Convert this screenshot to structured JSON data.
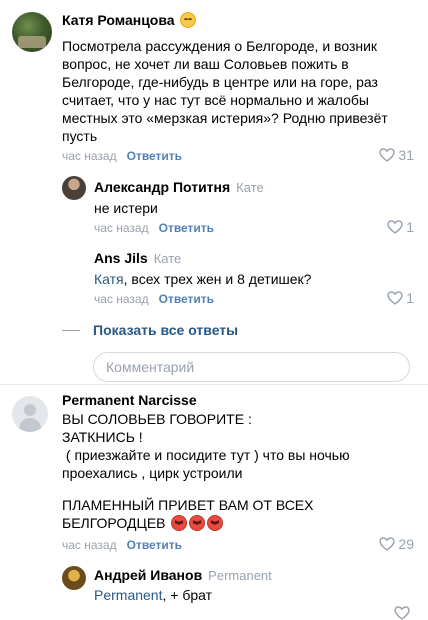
{
  "comments": [
    {
      "author": "Катя Романцова",
      "text": "Посмотрела рассуждения о Белгороде, и возник вопрос, не хочет ли ваш Соловьев пожить в Белгороде, где-нибудь в центре или на горе, раз считает, что у нас тут всё нормально и жалобы местных это «мерзкая истерия»? Родню привезёт пусть",
      "time": "час назад",
      "reply_label": "Ответить",
      "likes": "31",
      "replies": [
        {
          "author": "Александр Потитня",
          "reply_to": "Кате",
          "text": "не истери",
          "time": "час назад",
          "reply_label": "Ответить",
          "likes": "1"
        },
        {
          "author": "Ans Jils",
          "reply_to": "Кате",
          "mention": "Катя",
          "text": ", всех трех жен и 8 детишек?",
          "time": "час назад",
          "reply_label": "Ответить",
          "likes": "1"
        }
      ],
      "show_all_replies": "Показать все ответы",
      "comment_placeholder": "Комментарий"
    },
    {
      "author": "Permanent Narcisse",
      "text_lines": [
        "ВЫ СОЛОВЬЕВ ГОВОРИТЕ :",
        "ЗАТКНИСЬ !",
        " ( приезжайте и посидите тут ) что вы ночью проехались , цирк устроили"
      ],
      "text2": "ПЛАМЕННЫЙ ПРИВЕТ ВАМ ОТ ВСЕХ БЕЛГОРОДЦЕВ",
      "time": "час назад",
      "reply_label": "Ответить",
      "likes": "29",
      "replies": [
        {
          "author": "Андрей Иванов",
          "reply_to": "Permanent",
          "mention": "Permanent",
          "text": ", + брат"
        }
      ]
    }
  ],
  "icons": {
    "heart": "heart-outline-icon",
    "author_emoji": "smiling-face-emoji",
    "angry_emoji": "angry-face-emoji"
  },
  "colors": {
    "link": "#2a5885",
    "action": "#5181b8",
    "muted": "#99a2ad"
  }
}
